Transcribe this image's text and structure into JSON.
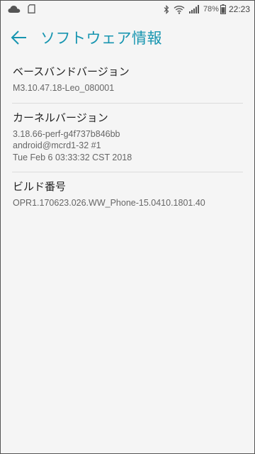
{
  "status_bar": {
    "battery": "78%",
    "time": "22:23",
    "icons": [
      "cloud-icon",
      "sd-card-icon",
      "bluetooth-icon",
      "wifi-icon",
      "signal-icon",
      "battery-icon"
    ]
  },
  "app_bar": {
    "title": "ソフトウェア情報",
    "accent_color": "#1795b0"
  },
  "items": [
    {
      "title": "ベースバンドバージョン",
      "lines": [
        "M3.10.47.18-Leo_080001"
      ]
    },
    {
      "title": "カーネルバージョン",
      "lines": [
        "3.18.66-perf-g4f737b846bb",
        "android@mcrd1-32 #1",
        "Tue Feb 6 03:33:32 CST 2018"
      ]
    },
    {
      "title": "ビルド番号",
      "lines": [
        "OPR1.170623.026.WW_Phone-15.0410.1801.40"
      ]
    }
  ]
}
